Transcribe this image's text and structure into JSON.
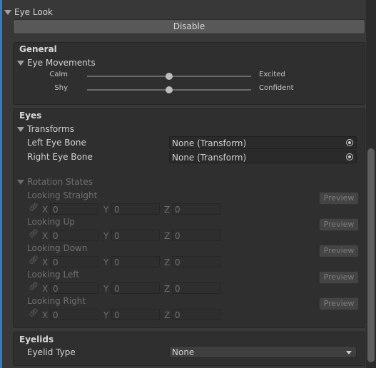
{
  "header": {
    "title": "Eye Look"
  },
  "disable_button": {
    "label": "Disable"
  },
  "general": {
    "title": "General",
    "eye_movements": {
      "label": "Eye Movements",
      "sliders": [
        {
          "left": "Calm",
          "right": "Excited",
          "value": 0.5
        },
        {
          "left": "Shy",
          "right": "Confident",
          "value": 0.5
        }
      ]
    }
  },
  "eyes": {
    "title": "Eyes",
    "transforms": {
      "label": "Transforms",
      "left_eye": {
        "label": "Left Eye Bone",
        "value": "None (Transform)"
      },
      "right_eye": {
        "label": "Right Eye Bone",
        "value": "None (Transform)"
      }
    },
    "rotation_states": {
      "label": "Rotation States",
      "preview_label": "Preview",
      "axes": [
        "X",
        "Y",
        "Z"
      ],
      "states": [
        {
          "name": "Looking Straight",
          "x": "0",
          "y": "0",
          "z": "0"
        },
        {
          "name": "Looking Up",
          "x": "0",
          "y": "0",
          "z": "0"
        },
        {
          "name": "Looking Down",
          "x": "0",
          "y": "0",
          "z": "0"
        },
        {
          "name": "Looking Left",
          "x": "0",
          "y": "0",
          "z": "0"
        },
        {
          "name": "Looking Right",
          "x": "0",
          "y": "0",
          "z": "0"
        }
      ]
    }
  },
  "eyelids": {
    "title": "Eyelids",
    "eyelid_type": {
      "label": "Eyelid Type",
      "value": "None"
    }
  },
  "colors": {
    "accent": "#3a79bb",
    "panel": "#2f2f2f",
    "background": "#383838"
  }
}
